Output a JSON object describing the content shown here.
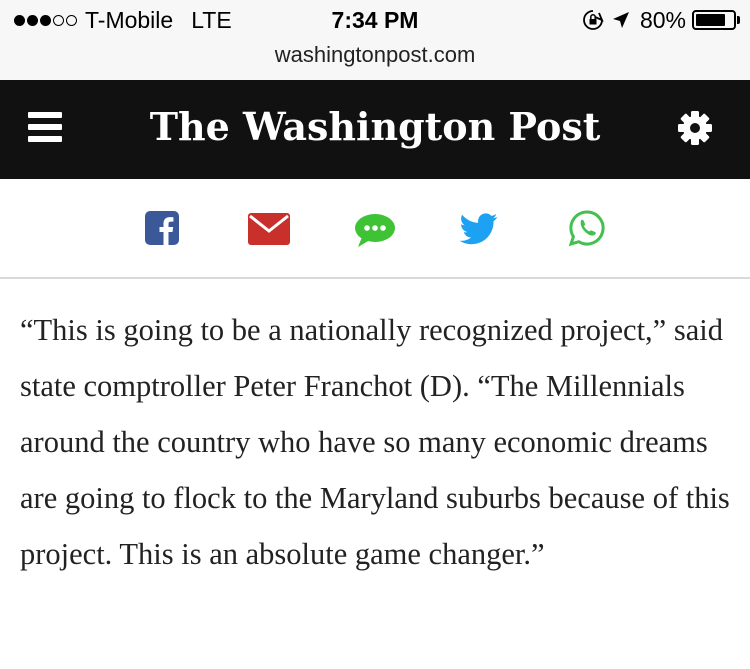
{
  "status_bar": {
    "carrier": "T-Mobile",
    "network": "LTE",
    "time": "7:34 PM",
    "battery": "80%",
    "battery_level": 0.8,
    "signal_bars": 3,
    "signal_total": 5
  },
  "browser": {
    "url": "washingtonpost.com"
  },
  "masthead": {
    "logo_text": "The Washington Post",
    "menu_icon": "hamburger-menu-icon",
    "settings_icon": "gear-icon"
  },
  "share": {
    "buttons": [
      {
        "name": "facebook",
        "icon": "facebook-icon",
        "color": "#3b5998"
      },
      {
        "name": "email",
        "icon": "envelope-icon",
        "color": "#c9302c"
      },
      {
        "name": "sms",
        "icon": "message-bubble-icon",
        "color": "#3ec335"
      },
      {
        "name": "twitter",
        "icon": "twitter-bird-icon",
        "color": "#1da1f2"
      },
      {
        "name": "whatsapp",
        "icon": "whatsapp-icon",
        "color": "#45c050"
      }
    ]
  },
  "article": {
    "paragraph": "“This is going to be a nationally recognized project,” said state comptroller Peter Franchot (D). “The Millennials around the country who have so many economic dreams are going to flock to the Maryland suburbs because of this project. This is an absolute game changer.”"
  },
  "colors": {
    "masthead_bg": "#111111",
    "status_bg": "#f7f7f7",
    "text": "#222222"
  }
}
